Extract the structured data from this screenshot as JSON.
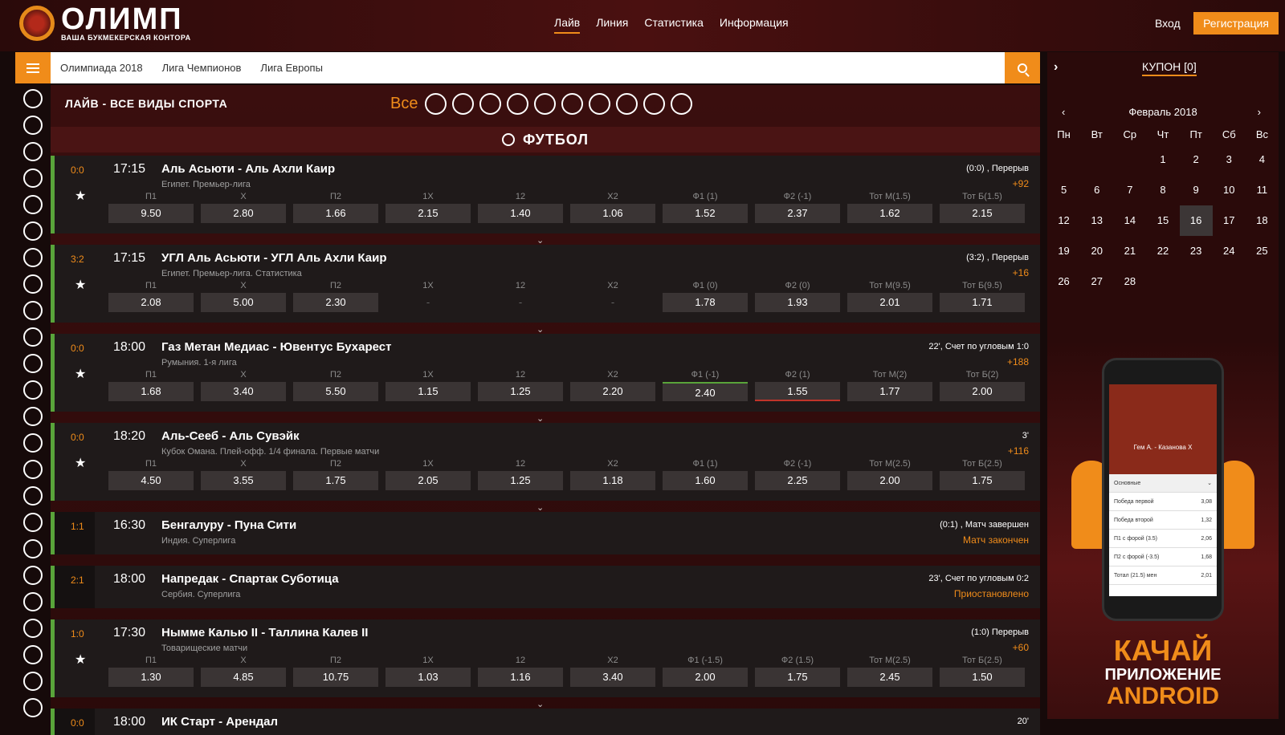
{
  "header": {
    "logo_main": "ОЛИМП",
    "logo_sub": "ВАША БУКМЕКЕРСКАЯ КОНТОРА",
    "nav": [
      "Лайв",
      "Линия",
      "Статистика",
      "Информация"
    ],
    "login": "Вход",
    "register": "Регистрация"
  },
  "subnav": {
    "links": [
      "Олимпиада 2018",
      "Лига Чемпионов",
      "Лига Европы"
    ]
  },
  "coupon": {
    "arrow": "›",
    "title": "КУПОН [0]"
  },
  "main": {
    "title": "ЛАЙВ - ВСЕ ВИДЫ СПОРТА",
    "filter_all": "Все",
    "sport_title": "ФУТБОЛ"
  },
  "events": [
    {
      "score": "0:0",
      "time": "17:15",
      "teams": "Аль Асьюти - Аль Ахли Каир",
      "league": "Египет. Премьер-лига",
      "status": "(0:0) , Перерыв",
      "extra": "+92",
      "star": "★",
      "chev": "⌄",
      "cells": [
        {
          "l": "П1",
          "v": "9.50"
        },
        {
          "l": "Х",
          "v": "2.80"
        },
        {
          "l": "П2",
          "v": "1.66"
        },
        {
          "l": "1Х",
          "v": "2.15"
        },
        {
          "l": "12",
          "v": "1.40"
        },
        {
          "l": "Х2",
          "v": "1.06"
        },
        {
          "l": "Ф1 (1)",
          "v": "1.52"
        },
        {
          "l": "Ф2 (-1)",
          "v": "2.37"
        },
        {
          "l": "Тот М(1.5)",
          "v": "1.62"
        },
        {
          "l": "Тот Б(1.5)",
          "v": "2.15"
        }
      ]
    },
    {
      "score": "3:2",
      "time": "17:15",
      "teams": "УГЛ Аль Асьюти - УГЛ Аль Ахли Каир",
      "league": "Египет. Премьер-лига. Статистика",
      "status": "(3:2) , Перерыв",
      "extra": "+16",
      "star": "★",
      "chev": "⌄",
      "cells": [
        {
          "l": "П1",
          "v": "2.08"
        },
        {
          "l": "Х",
          "v": "5.00"
        },
        {
          "l": "П2",
          "v": "2.30"
        },
        {
          "l": "1Х",
          "v": "-"
        },
        {
          "l": "12",
          "v": "-"
        },
        {
          "l": "Х2",
          "v": "-"
        },
        {
          "l": "Ф1 (0)",
          "v": "1.78"
        },
        {
          "l": "Ф2 (0)",
          "v": "1.93"
        },
        {
          "l": "Тот М(9.5)",
          "v": "2.01"
        },
        {
          "l": "Тот Б(9.5)",
          "v": "1.71"
        }
      ]
    },
    {
      "score": "0:0",
      "time": "18:00",
      "teams": "Газ Метан Медиас - Ювентус Бухарест",
      "league": "Румыния. 1-я лига",
      "status": "22', Счет по угловым 1:0",
      "extra": "+188",
      "star": "★",
      "chev": "⌄",
      "cells": [
        {
          "l": "П1",
          "v": "1.68"
        },
        {
          "l": "Х",
          "v": "3.40"
        },
        {
          "l": "П2",
          "v": "5.50"
        },
        {
          "l": "1Х",
          "v": "1.15"
        },
        {
          "l": "12",
          "v": "1.25"
        },
        {
          "l": "Х2",
          "v": "2.20"
        },
        {
          "l": "Ф1 (-1)",
          "v": "2.40"
        },
        {
          "l": "Ф2 (1)",
          "v": "1.55"
        },
        {
          "l": "Тот М(2)",
          "v": "1.77"
        },
        {
          "l": "Тот Б(2)",
          "v": "2.00"
        }
      ]
    },
    {
      "score": "0:0",
      "time": "18:20",
      "teams": "Аль-Сееб - Аль Сувэйк",
      "league": "Кубок Омана. Плей-офф. 1/4 финала. Первые матчи",
      "status": "3'",
      "extra": "+116",
      "star": "★",
      "chev": "⌄",
      "cells": [
        {
          "l": "П1",
          "v": "4.50"
        },
        {
          "l": "Х",
          "v": "3.55"
        },
        {
          "l": "П2",
          "v": "1.75"
        },
        {
          "l": "1Х",
          "v": "2.05"
        },
        {
          "l": "12",
          "v": "1.25"
        },
        {
          "l": "Х2",
          "v": "1.18"
        },
        {
          "l": "Ф1 (1)",
          "v": "1.60"
        },
        {
          "l": "Ф2 (-1)",
          "v": "2.25"
        },
        {
          "l": "Тот М(2.5)",
          "v": "2.00"
        },
        {
          "l": "Тот Б(2.5)",
          "v": "1.75"
        }
      ]
    },
    {
      "score": "1:1",
      "time": "16:30",
      "teams": "Бенгалуру - Пуна Сити",
      "league": "Индия. Суперлига",
      "status": "(0:1) , Матч завершен",
      "extra": "Матч закончен"
    },
    {
      "score": "2:1",
      "time": "18:00",
      "teams": "Напредак - Спартак Суботица",
      "league": "Сербия. Суперлига",
      "status": "23', Счет по угловым 0:2",
      "extra": "Приостановлено"
    },
    {
      "score": "1:0",
      "time": "17:30",
      "teams": "Нымме Калью II - Таллина Калев II",
      "league": "Товарищеские матчи",
      "status": "(1:0) Перерыв",
      "extra": "+60",
      "star": "★",
      "chev": "⌄",
      "cells": [
        {
          "l": "П1",
          "v": "1.30"
        },
        {
          "l": "Х",
          "v": "4.85"
        },
        {
          "l": "П2",
          "v": "10.75"
        },
        {
          "l": "1Х",
          "v": "1.03"
        },
        {
          "l": "12",
          "v": "1.16"
        },
        {
          "l": "Х2",
          "v": "3.40"
        },
        {
          "l": "Ф1 (-1.5)",
          "v": "2.00"
        },
        {
          "l": "Ф2 (1.5)",
          "v": "1.75"
        },
        {
          "l": "Тот М(2.5)",
          "v": "2.45"
        },
        {
          "l": "Тот Б(2.5)",
          "v": "1.50"
        }
      ]
    },
    {
      "score": "0:0",
      "time": "18:00",
      "teams": "ИК Старт - Арендал",
      "status": "20'"
    }
  ],
  "calendar": {
    "month": "Февраль 2018",
    "prev": "‹",
    "next": "›",
    "weekdays": [
      "Пн",
      "Вт",
      "Ср",
      "Чт",
      "Пт",
      "Сб",
      "Вс"
    ],
    "leading_blanks": 3,
    "days": 28,
    "today": 16
  },
  "ad": {
    "match": "Гем А. - Казанова Х",
    "section": "Основные",
    "rows": [
      {
        "name": "Победа первой",
        "odd": "3,08"
      },
      {
        "name": "Победа второй",
        "odd": "1,32"
      },
      {
        "name": "П1 с форой (3.5)",
        "odd": "2,06"
      },
      {
        "name": "П2 с форой (-3.5)",
        "odd": "1,68"
      },
      {
        "name": "Тотал (21.5) мен",
        "odd": "2,01"
      }
    ],
    "line1": "КАЧАЙ",
    "line2": "ПРИЛОЖЕНИЕ",
    "line3": "ANDROID"
  },
  "colors": {
    "accent": "#f08c1a",
    "live_border": "#59a43a",
    "down": "#c0342a"
  },
  "sidebar_icons": [
    "soccer-ball-icon",
    "tennis-ball-icon",
    "basketball-icon",
    "hockey-puck-icon",
    "volleyball-icon",
    "badminton-icon",
    "table-tennis-icon",
    "skiing-icon",
    "athletics-icon",
    "gamepad-icon",
    "skating-icon",
    "football-helmet-icon",
    "rugby-ball-icon",
    "bobsleigh-icon",
    "biathlon-icon",
    "hockey-stick-icon",
    "cricket-bat-icon",
    "darts-icon",
    "curling-icon",
    "golf-icon",
    "racing-car-icon",
    "swimming-icon",
    "ski-jump-icon",
    "luge-icon"
  ],
  "filter_icons": [
    "soccer-ball-icon",
    "tennis-ball-icon",
    "basketball-icon",
    "hockey-puck-icon",
    "volleyball-icon",
    "athletics-icon",
    "gamepad-icon",
    "table-tennis-icon",
    "badminton-icon",
    "hockey-stick-icon"
  ]
}
